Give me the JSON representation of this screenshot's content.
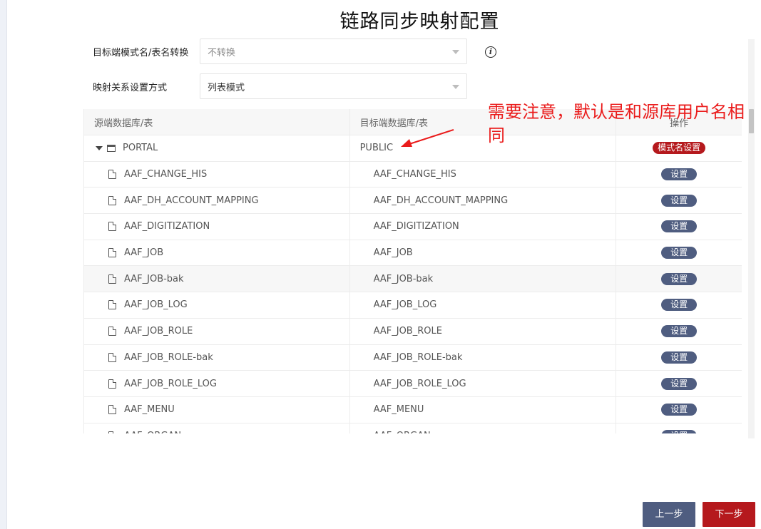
{
  "title": "链路同步映射配置",
  "form": {
    "schema_convert_label": "目标端模式名/表名转换",
    "schema_convert_value": "不转换",
    "mapping_mode_label": "映射关系设置方式",
    "mapping_mode_value": "列表模式"
  },
  "table": {
    "headers": {
      "source": "源端数据库/表",
      "target": "目标端数据库/表",
      "action": "操作"
    },
    "parent": {
      "source": "PORTAL",
      "target": "PUBLIC",
      "action": "模式名设置"
    },
    "rows": [
      {
        "source": "AAF_CHANGE_HIS",
        "target": "AAF_CHANGE_HIS",
        "action": "设置"
      },
      {
        "source": "AAF_DH_ACCOUNT_MAPPING",
        "target": "AAF_DH_ACCOUNT_MAPPING",
        "action": "设置"
      },
      {
        "source": "AAF_DIGITIZATION",
        "target": "AAF_DIGITIZATION",
        "action": "设置"
      },
      {
        "source": "AAF_JOB",
        "target": "AAF_JOB",
        "action": "设置"
      },
      {
        "source": "AAF_JOB-bak",
        "target": "AAF_JOB-bak",
        "action": "设置"
      },
      {
        "source": "AAF_JOB_LOG",
        "target": "AAF_JOB_LOG",
        "action": "设置"
      },
      {
        "source": "AAF_JOB_ROLE",
        "target": "AAF_JOB_ROLE",
        "action": "设置"
      },
      {
        "source": "AAF_JOB_ROLE-bak",
        "target": "AAF_JOB_ROLE-bak",
        "action": "设置"
      },
      {
        "source": "AAF_JOB_ROLE_LOG",
        "target": "AAF_JOB_ROLE_LOG",
        "action": "设置"
      },
      {
        "source": "AAF_MENU",
        "target": "AAF_MENU",
        "action": "设置"
      },
      {
        "source": "AAF_ORGAN",
        "target": "AAF_ORGAN",
        "action": "设置"
      }
    ]
  },
  "annotation": "需要注意，默认是和源库用户名相同",
  "buttons": {
    "prev": "上一步",
    "next": "下一步"
  },
  "colors": {
    "accent_red": "#b5191d",
    "accent_blue": "#4f5d80",
    "annotation_red": "#ea1b1b"
  }
}
